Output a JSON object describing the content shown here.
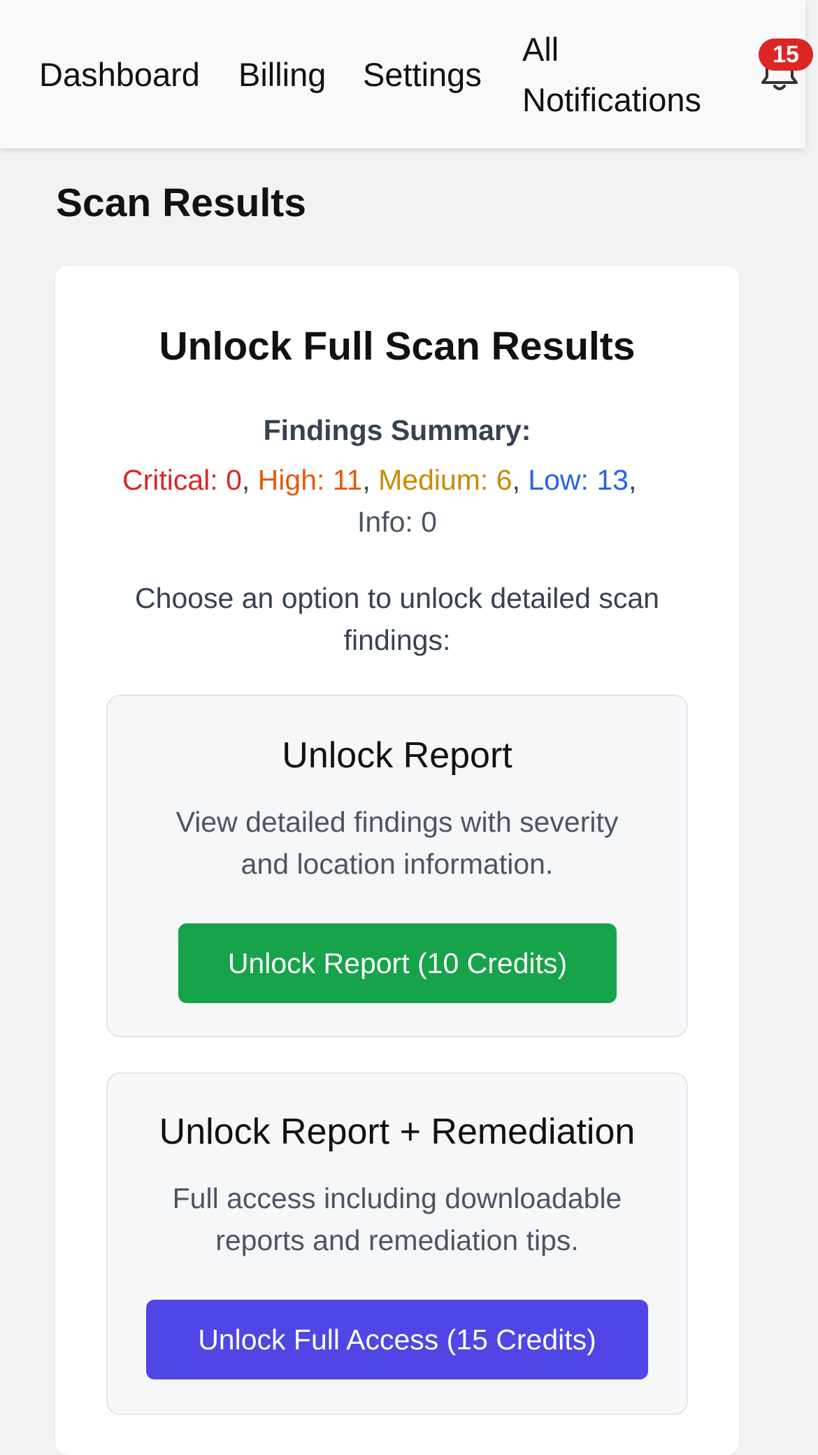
{
  "nav": {
    "items": [
      "Dashboard",
      "Billing",
      "Settings"
    ],
    "all_notifications_line1": "All",
    "all_notifications_line2": "Notifications",
    "badge_count": "15"
  },
  "page": {
    "title": "Scan Results"
  },
  "card": {
    "title": "Unlock Full Scan Results",
    "summary_title": "Findings Summary:",
    "summary": {
      "critical": "Critical: 0",
      "high": "High: 11",
      "medium": "Medium: 6",
      "low": "Low: 13",
      "info": "Info: 0",
      "separator": ", "
    },
    "prompt_line1": "Choose an option to unlock detailed scan",
    "prompt_line2": "findings:",
    "options": [
      {
        "title": "Unlock Report",
        "desc_line1": "View detailed findings with severity",
        "desc_line2": "and location information.",
        "button": "Unlock Report (10 Credits)"
      },
      {
        "title": "Unlock Report + Remediation",
        "desc_line1": "Full access including downloadable",
        "desc_line2": "reports and remediation tips.",
        "button": "Unlock Full Access (15 Credits)"
      }
    ]
  },
  "colors": {
    "critical": "#dc2626",
    "high": "#ea580c",
    "medium": "#ca8a04",
    "low": "#2563eb",
    "report_button": "#16a34a",
    "full_access_button": "#4f46e5",
    "badge": "#dc2626"
  },
  "icons": {
    "notifications": "bell-icon"
  }
}
